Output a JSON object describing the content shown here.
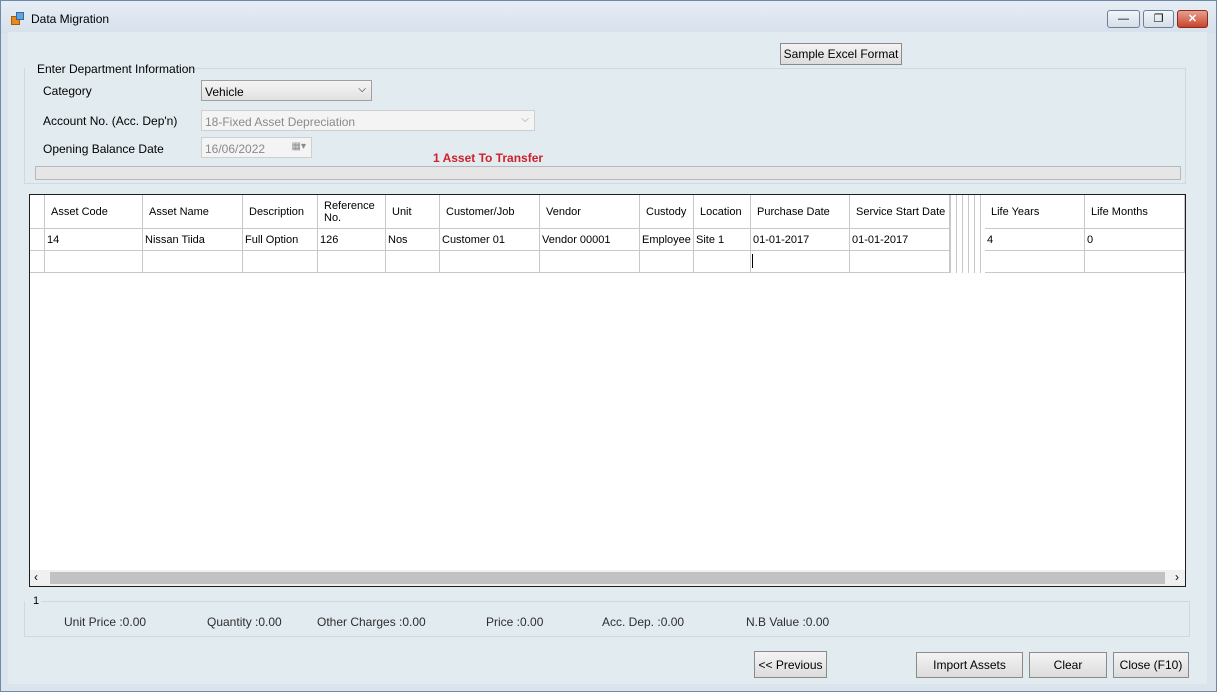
{
  "window": {
    "title": "Data Migration",
    "min_glyph": "—",
    "max_glyph": "❐",
    "close_glyph": "✕"
  },
  "top": {
    "sample_excel_label": "Sample Excel Format"
  },
  "dept": {
    "group_title": "Enter Department Information",
    "category_label": "Category",
    "category_value": "Vehicle",
    "account_label": "Account No. (Acc. Dep'n)",
    "account_value": "18-Fixed Asset Depreciation",
    "opening_label": "Opening Balance Date",
    "opening_value": "16/06/2022",
    "transfer_status": "1 Asset To Transfer"
  },
  "grid": {
    "headers": [
      "Asset Code",
      "Asset Name",
      "Description",
      "Reference No.",
      "Unit",
      "Customer/Job",
      "Vendor",
      "Custody",
      "Location",
      "Purchase Date",
      "Service Start Date",
      "Life Years",
      "Life Months"
    ],
    "rows": [
      [
        "14",
        "Nissan Tiida",
        "Full Option",
        "126",
        "Nos",
        "Customer 01",
        "Vendor 00001",
        "Employee",
        "Site 1",
        "01-01-2017",
        "01-01-2017",
        "4",
        "0"
      ]
    ]
  },
  "summary": {
    "group_number": "1",
    "unit_price": "Unit Price :0.00",
    "quantity": "Quantity :0.00",
    "other_charges": "Other Charges :0.00",
    "price": "Price :0.00",
    "acc_dep": "Acc. Dep. :0.00",
    "nb_value": "N.B Value :0.00"
  },
  "buttons": {
    "previous": "<< Previous",
    "import": "Import Assets",
    "clear": "Clear",
    "close": "Close (F10)"
  },
  "colors": {
    "status_red": "#d0202a",
    "title_bar": "#dfe7f0",
    "grid_border": "#1e1e1e"
  }
}
